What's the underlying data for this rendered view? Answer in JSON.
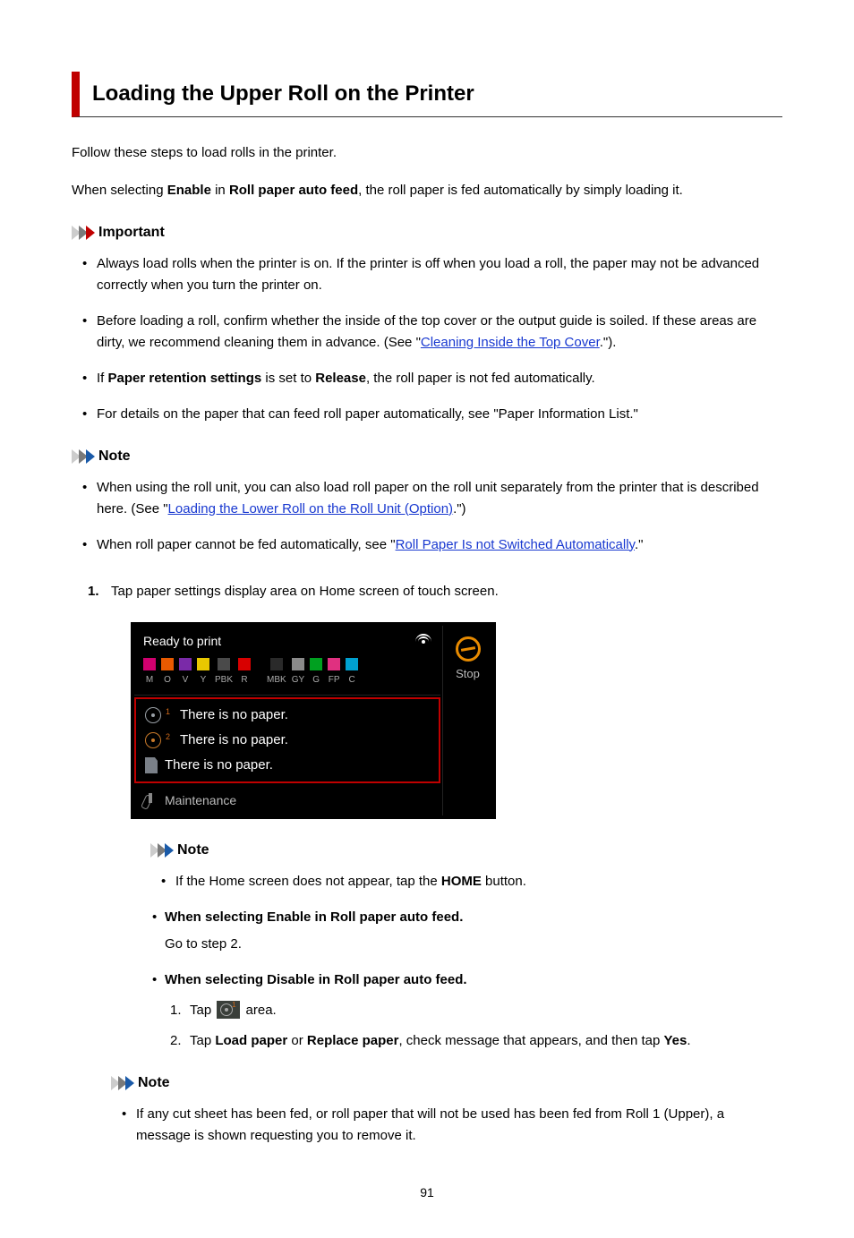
{
  "title": "Loading the Upper Roll on the Printer",
  "intro1": "Follow these steps to load rolls in the printer.",
  "intro2_pre": "When selecting ",
  "intro2_b1": "Enable",
  "intro2_mid": " in ",
  "intro2_b2": "Roll paper auto feed",
  "intro2_post": ", the roll paper is fed automatically by simply loading it.",
  "important_label": "Important",
  "important": {
    "i1": "Always load rolls when the printer is on. If the printer is off when you load a roll, the paper may not be advanced correctly when you turn the printer on.",
    "i2_pre": "Before loading a roll, confirm whether the inside of the top cover or the output guide is soiled. If these areas are dirty, we recommend cleaning them in advance. (See \"",
    "i2_link": "Cleaning Inside the Top Cover",
    "i2_post": ".\").",
    "i3_pre": "If ",
    "i3_b1": "Paper retention settings",
    "i3_mid": " is set to ",
    "i3_b2": "Release",
    "i3_post": ", the roll paper is not fed automatically.",
    "i4": "For details on the paper that can feed roll paper automatically, see \"Paper Information List.\""
  },
  "note_label": "Note",
  "note1": {
    "n1_pre": "When using the roll unit, you can also load roll paper on the roll unit separately from the printer that is described here. (See \"",
    "n1_link": "Loading the Lower Roll on the Roll Unit (Option)",
    "n1_post": ".\")",
    "n2_pre": "When roll paper cannot be fed automatically, see \"",
    "n2_link": "Roll Paper Is not Switched Automatically",
    "n2_post": ".\""
  },
  "step1_num": "1.",
  "step1_text": "Tap paper settings display area on Home screen of touch screen.",
  "screen": {
    "ready": "Ready to print",
    "inks": [
      {
        "lbl": "M",
        "color": "#d0006f"
      },
      {
        "lbl": "O",
        "color": "#e85a00"
      },
      {
        "lbl": "V",
        "color": "#7a2aa8"
      },
      {
        "lbl": "Y",
        "color": "#e8c800"
      },
      {
        "lbl": "PBK",
        "color": "#4a4a4a"
      },
      {
        "lbl": "R",
        "color": "#d80000"
      }
    ],
    "inks2": [
      {
        "lbl": "MBK",
        "color": "#2a2a2a"
      },
      {
        "lbl": "GY",
        "color": "#8a8a8a"
      },
      {
        "lbl": "G",
        "color": "#00a020"
      },
      {
        "lbl": "FP",
        "color": "#e03080"
      },
      {
        "lbl": "C",
        "color": "#00a0d0"
      }
    ],
    "row1": "There is no paper.",
    "row2": "There is no paper.",
    "row3": "There is no paper.",
    "maintenance": "Maintenance",
    "stop": "Stop"
  },
  "note2": {
    "n1_pre": "If the Home screen does not appear, tap the ",
    "n1_b": "HOME",
    "n1_post": " button."
  },
  "cases": {
    "c1_head": "When selecting Enable in Roll paper auto feed.",
    "c1_body": "Go to step 2.",
    "c2_head": "When selecting Disable in Roll paper auto feed.",
    "s1a": "Tap ",
    "s1b": " area.",
    "s2_pre": "Tap ",
    "s2_b1": "Load paper",
    "s2_mid1": " or ",
    "s2_b2": "Replace paper",
    "s2_mid2": ", check message that appears, and then tap ",
    "s2_b3": "Yes",
    "s2_post": "."
  },
  "note3": {
    "n1": "If any cut sheet has been fed, or roll paper that will not be used has been fed from Roll 1 (Upper), a message is shown requesting you to remove it."
  },
  "pagenum": "91",
  "substep_1": "1.",
  "substep_2": "2."
}
